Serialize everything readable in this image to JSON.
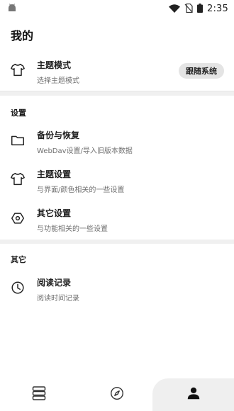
{
  "status_bar": {
    "time": "2:35"
  },
  "page": {
    "title": "我的"
  },
  "theme_mode": {
    "title": "主题模式",
    "subtitle": "选择主题模式",
    "value": "跟随系统",
    "icon": "tshirt-icon"
  },
  "settings_section": {
    "label": "设置",
    "items": [
      {
        "title": "备份与恢复",
        "subtitle": "WebDav设置/导入旧版本数据",
        "icon": "folder-icon"
      },
      {
        "title": "主题设置",
        "subtitle": "与界面/颜色相关的一些设置",
        "icon": "tshirt-icon"
      },
      {
        "title": "其它设置",
        "subtitle": "与功能相关的一些设置",
        "icon": "hexagon-icon"
      }
    ]
  },
  "other_section": {
    "label": "其它",
    "items": [
      {
        "title": "阅读记录",
        "subtitle": "阅读时间记录",
        "icon": "clock-icon"
      }
    ]
  },
  "bottom_nav": {
    "items": [
      {
        "icon": "bookshelf-icon",
        "active": false
      },
      {
        "icon": "compass-icon",
        "active": false
      },
      {
        "icon": "person-icon",
        "active": true
      }
    ]
  },
  "colors": {
    "accent": "#222222",
    "chip_bg": "#e4e4e4",
    "divider": "#f0f0f0"
  }
}
